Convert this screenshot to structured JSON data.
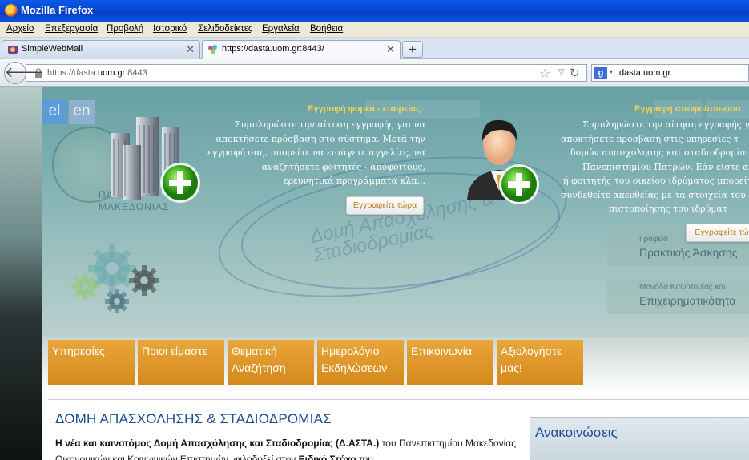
{
  "window": {
    "title": "Mozilla Firefox"
  },
  "menu": [
    "Αρχείο",
    "Επεξεργασία",
    "Προβολή",
    "Ιστορικό",
    "Σελιδοδείκτες",
    "Εργαλεία",
    "Βοήθεια"
  ],
  "tabs": [
    {
      "label": "SimpleWebMail",
      "active": false
    },
    {
      "label": "https://dasta.uom.gr:8443/",
      "active": true
    }
  ],
  "newtab_label": "+",
  "address": {
    "url_prefix": "https://dasta.",
    "url_host": "uom.gr",
    "url_suffix": ":8443"
  },
  "search": {
    "engine": "g",
    "query": "dasta.uom.gr"
  },
  "site": {
    "lang": [
      "el",
      "en"
    ],
    "seal_text": "ΠΑΝΕΠΙΣΤΗΜΙΟ ΜΑΚΕΔΟΝΙΑΣ",
    "seal_line1": "ΠΑΝΕΠΙ",
    "seal_line2": "ΜΑΚΕΔΟΝΙΑΣ",
    "watermark_line1": "Δομή Απασχόλησης &",
    "watermark_line2": "Σταδιοδρομίας",
    "org_register": {
      "title": "Εγγραφή φορέα - εταιρείας",
      "lines": [
        "Συμπληρώστε την αίτηση εγγραφής για να",
        "αποκτήσετε πρόσβαση στο σύστημα. Μετά την",
        "εγγραφή σας, μπορείτε να εισάγετε αγγελίες, να",
        "αναζητήσετε φοιτητές - απόφοιτους,",
        "ερευνητικά προγράμματα κλπ..."
      ],
      "button": "Εγγραφείτε τώρα"
    },
    "grad_register": {
      "title": "Εγγραφή αποφοίτου-φοιτ",
      "lines": [
        "Συμπληρώστε την αίτηση εγγραφής για",
        "αποκτήσετε πρόσβαση στις υπηρεσίες τ",
        "δομών απασχόλησης και σταδιοδρομίας",
        "Πανεπιστημίου Πατρών. Εάν είστε απόφοι",
        "ή φοιτητής του οικείου ιδρύματος μπορείτ",
        "συνδεθείτε απευθείας με τα στοιχεία του φοι",
        "πιστοποίησης του ιδρύματ"
      ],
      "button": "Εγγραφείτε τώ"
    },
    "side_boxes": [
      {
        "small": "Γραφείο",
        "big": "Πρακτικής Άσκησης"
      },
      {
        "small": "Μονάδα Καινοτομίας και",
        "big": "Επιχειρηματικότητα"
      }
    ],
    "nav": [
      {
        "label": "Υπηρεσίες"
      },
      {
        "label": "Ποιοι είμαστε"
      },
      {
        "label": "Θεματική Αναζήτηση"
      },
      {
        "label": "Ημερολόγιο Εκδηλώσεων"
      },
      {
        "label": "Επικοινωνία"
      },
      {
        "label": "Αξιολογήστε μας!"
      }
    ],
    "section_title": "ΔΟΜΗ ΑΠΑΣΧΟΛΗΣΗΣ & ΣΤΑΔΙΟΔΡΟΜΙΑΣ",
    "intro": {
      "bold1": "Η νέα και καινοτόμος Δομή Απασχόλησης και Σταδιοδρομίας (Δ.ΑΣΤΑ.)",
      "text1": " του Πανεπιστημίου Μακεδονίας Οικονομικών και Κοινωνικών Επιστημών, φιλοδοξεί στον ",
      "bold2": "Ειδικό Στόχο",
      "text2": " του"
    },
    "announcements_title": "Ανακοινώσεις"
  }
}
